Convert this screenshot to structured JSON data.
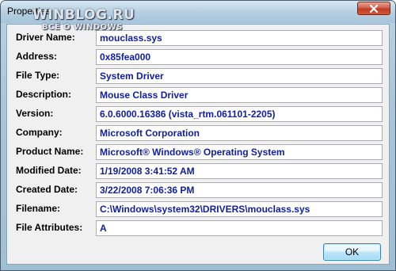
{
  "window": {
    "title": "Properties",
    "close_icon": "close-icon"
  },
  "watermark": {
    "main": "WINBLOG.RU",
    "sub": "ВСЁ О WINDOWS"
  },
  "fields": [
    {
      "label": "Driver Name:",
      "value": "mouclass.sys"
    },
    {
      "label": "Address:",
      "value": "0x85fea000"
    },
    {
      "label": "File Type:",
      "value": "System Driver"
    },
    {
      "label": "Description:",
      "value": "Mouse Class Driver"
    },
    {
      "label": "Version:",
      "value": "6.0.6000.16386 (vista_rtm.061101-2205)"
    },
    {
      "label": "Company:",
      "value": "Microsoft Corporation"
    },
    {
      "label": "Product Name:",
      "value": "Microsoft® Windows® Operating System"
    },
    {
      "label": "Modified Date:",
      "value": "1/19/2008 3:41:52 AM"
    },
    {
      "label": "Created Date:",
      "value": "3/22/2008 7:06:36 PM"
    },
    {
      "label": "Filename:",
      "value": "C:\\Windows\\system32\\DRIVERS\\mouclass.sys"
    },
    {
      "label": "File Attributes:",
      "value": "A"
    }
  ],
  "buttons": {
    "ok_label": "OK"
  },
  "colors": {
    "value_text": "#1020a0",
    "title_bar": "#b6d0e2"
  }
}
